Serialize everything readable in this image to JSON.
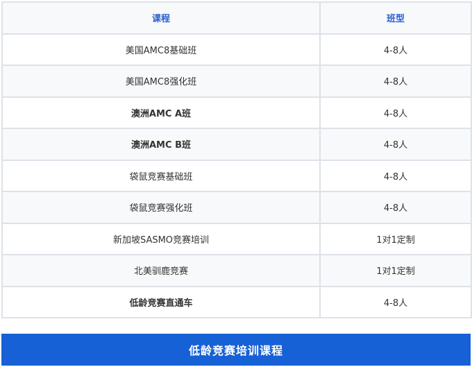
{
  "table": {
    "headers": [
      "课程",
      "班型"
    ],
    "rows": [
      {
        "course": "美国AMC8基础班",
        "type": "4-8人",
        "highlight": false
      },
      {
        "course": "美国AMC8强化班",
        "type": "4-8人",
        "highlight": false
      },
      {
        "course": "澳洲AMC A班",
        "type": "4-8人",
        "highlight": true
      },
      {
        "course": "澳洲AMC B班",
        "type": "4-8人",
        "highlight": true
      },
      {
        "course": "袋鼠竞赛基础班",
        "type": "4-8人",
        "highlight": false
      },
      {
        "course": "袋鼠竞赛强化班",
        "type": "4-8人",
        "highlight": false
      },
      {
        "course": "新加坡SASMO竞赛培训",
        "type": "1对1定制",
        "highlight": false
      },
      {
        "course": "北美驯鹿竞赛",
        "type": "1对1定制",
        "highlight": false
      },
      {
        "course": "低龄竞赛直通车",
        "type": "4-8人",
        "highlight": true
      }
    ]
  },
  "footer": {
    "label": "低龄竞赛培训课程"
  },
  "colors": {
    "header_text": "#2a5fd0",
    "highlight_text": "#e04a3a",
    "footer_bg": "#1661d6",
    "border": "#dde2e8"
  }
}
